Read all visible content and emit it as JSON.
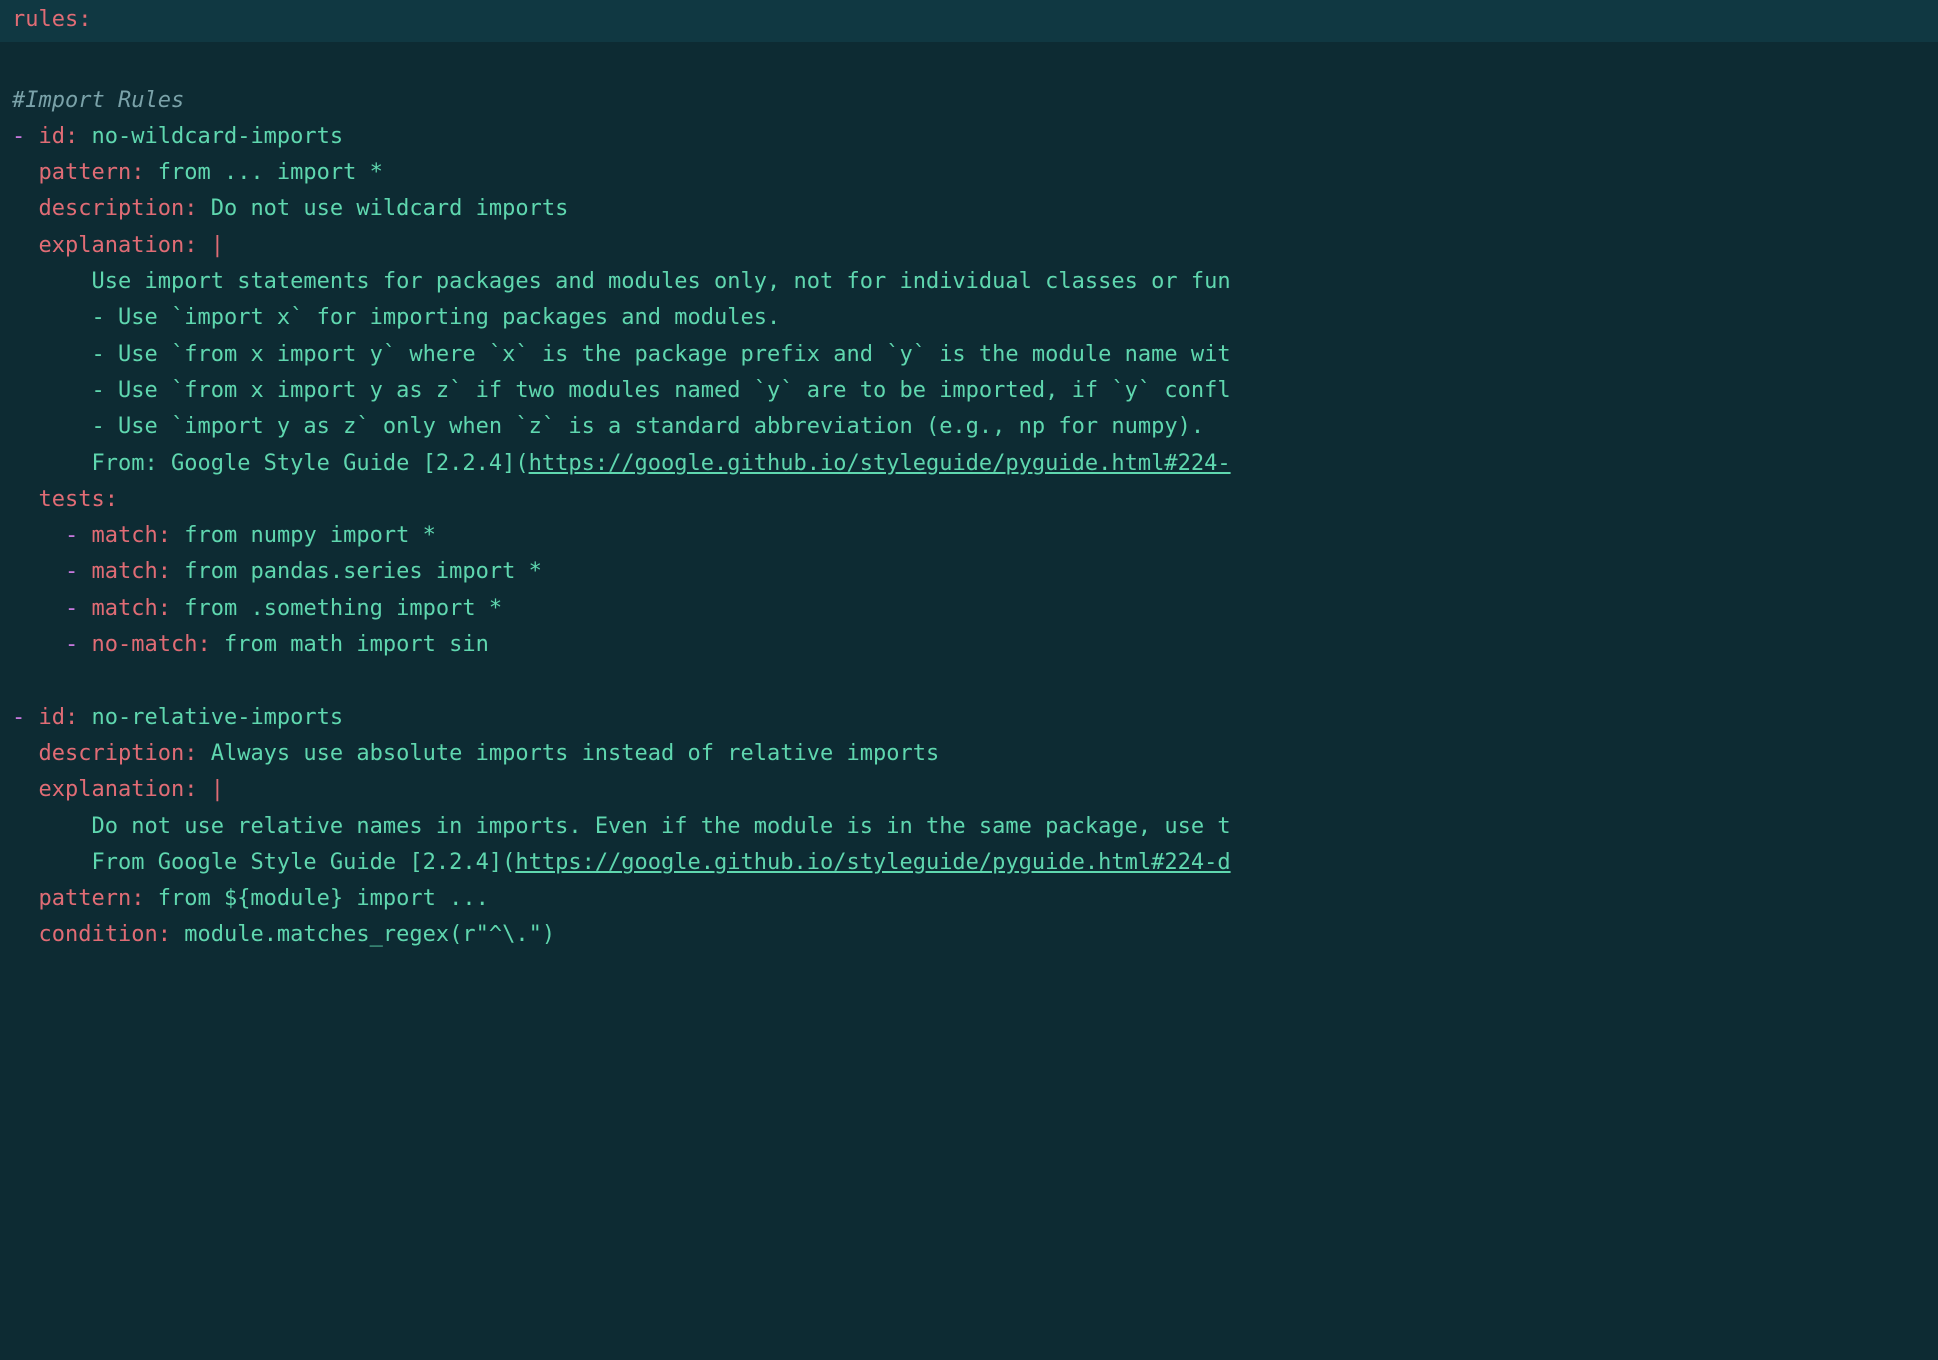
{
  "topline": {
    "key": "rules",
    "colon": ":"
  },
  "comment1": "#Import Rules",
  "rule1": {
    "dash": "-",
    "id_key": "id",
    "id_val": "no-wildcard-imports",
    "pattern_key": "pattern",
    "pattern_val": "from ... import *",
    "description_key": "description",
    "description_val": "Do not use wildcard imports",
    "explanation_key": "explanation",
    "pipe": "|",
    "exp_l1": "Use import statements for packages and modules only, not for individual classes or fun",
    "exp_l2": "- Use `import x` for importing packages and modules.",
    "exp_l3": "- Use `from x import y` where `x` is the package prefix and `y` is the module name wit",
    "exp_l4": "- Use `from x import y as z` if two modules named `y` are to be imported, if `y` confl",
    "exp_l5": "- Use `import y as z` only when `z` is a standard abbreviation (e.g., np for numpy).",
    "exp_l6a": "From: Google Style Guide [2.2.4](",
    "exp_l6_url": "https://google.github.io/styleguide/pyguide.html#224-",
    "tests_key": "tests",
    "t1_key": "match",
    "t1_val": "from numpy import *",
    "t2_key": "match",
    "t2_val": "from pandas.series import *",
    "t3_key": "match",
    "t3_val": "from .something import *",
    "t4_key": "no-match",
    "t4_val": "from math import sin"
  },
  "rule2": {
    "dash": "-",
    "id_key": "id",
    "id_val": "no-relative-imports",
    "description_key": "description",
    "description_val": "Always use absolute imports instead of relative imports",
    "explanation_key": "explanation",
    "pipe": "|",
    "exp_l1": "Do not use relative names in imports. Even if the module is in the same package, use t",
    "exp_l2a": "From Google Style Guide [2.2.4](",
    "exp_l2_url": "https://google.github.io/styleguide/pyguide.html#224-d",
    "pattern_key": "pattern",
    "pattern_val": "from ${module} import ...",
    "condition_key": "condition",
    "condition_val": "module.matches_regex(r\"^\\.\")"
  }
}
